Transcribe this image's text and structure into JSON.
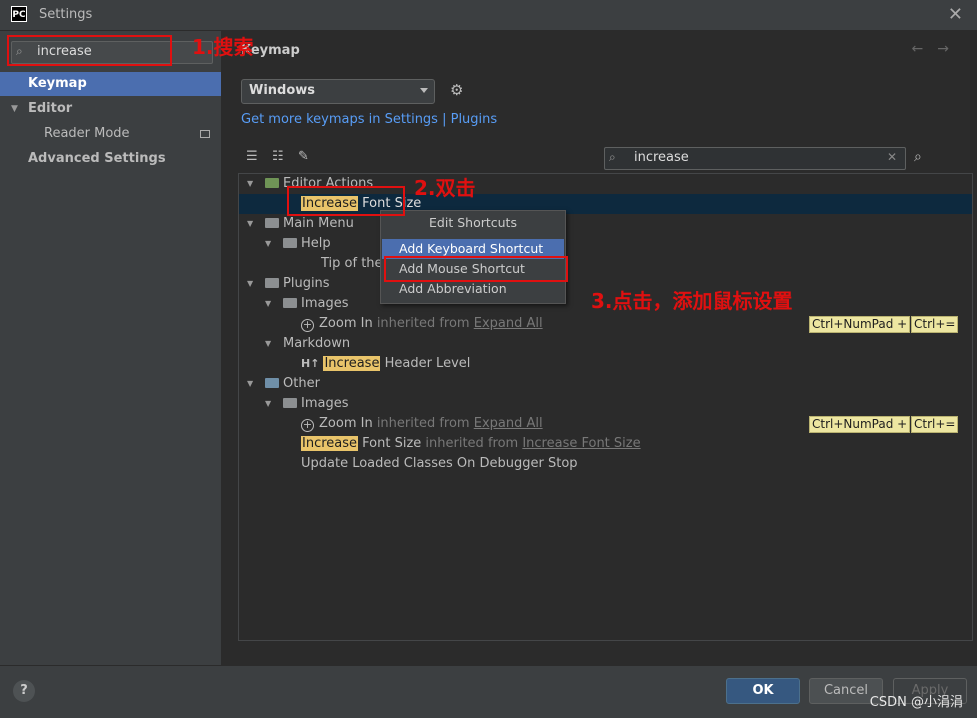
{
  "window": {
    "title": "Settings",
    "logo": "PC"
  },
  "sidebar": {
    "search_value": "increase",
    "items": [
      {
        "label": "Keymap",
        "selected": true
      },
      {
        "label": "Editor"
      },
      {
        "label": "Reader Mode"
      },
      {
        "label": "Advanced Settings"
      }
    ]
  },
  "main": {
    "breadcrumb": "Keymap",
    "keymap_select": "Windows",
    "more_link": "Get more keymaps in Settings | Plugins",
    "filter_value": "increase",
    "tree": {
      "editor_actions": "Editor Actions",
      "increase_font_size_hl": "Increase",
      "increase_font_size_rest": " Font Size",
      "main_menu": "Main Menu",
      "help": "Help",
      "tip_of_the": "Tip of the",
      "plugins": "Plugins",
      "images": "Images",
      "zoom_in": "Zoom In",
      "inherited_from": " inherited from ",
      "expand_all": "Expand All",
      "shortcut_1": "Ctrl+NumPad +",
      "shortcut_2": "Ctrl+=",
      "markdown": "Markdown",
      "ht_icon": "H↑",
      "header_level_hl": "Increase",
      "header_level_rest": " Header Level",
      "other": "Other",
      "images_2": "Images",
      "zoom_in_2": "Zoom In",
      "inherited_from_2": " inherited from ",
      "expand_all_2": "Expand All",
      "shortcut_3": "Ctrl+NumPad +",
      "shortcut_4": "Ctrl+=",
      "inc_font_hl_2": "Increase",
      "inc_font_rest_2": " Font Size",
      "inherited_from_3": " inherited from ",
      "inc_font_link": "Increase Font Size",
      "update_loaded": "Update Loaded Classes On Debugger Stop"
    }
  },
  "context_menu": {
    "title": "Edit Shortcuts",
    "items": [
      "Add Keyboard Shortcut",
      "Add Mouse Shortcut",
      "Add Abbreviation"
    ]
  },
  "annotations": {
    "step1": "1.搜索",
    "step2": "2.双击",
    "step3": "3.点击，添加鼠标设置",
    "color": "#e01010"
  },
  "footer": {
    "help": "?",
    "ok": "OK",
    "cancel": "Cancel",
    "apply": "Apply",
    "watermark": "CSDN @小涓涓"
  }
}
